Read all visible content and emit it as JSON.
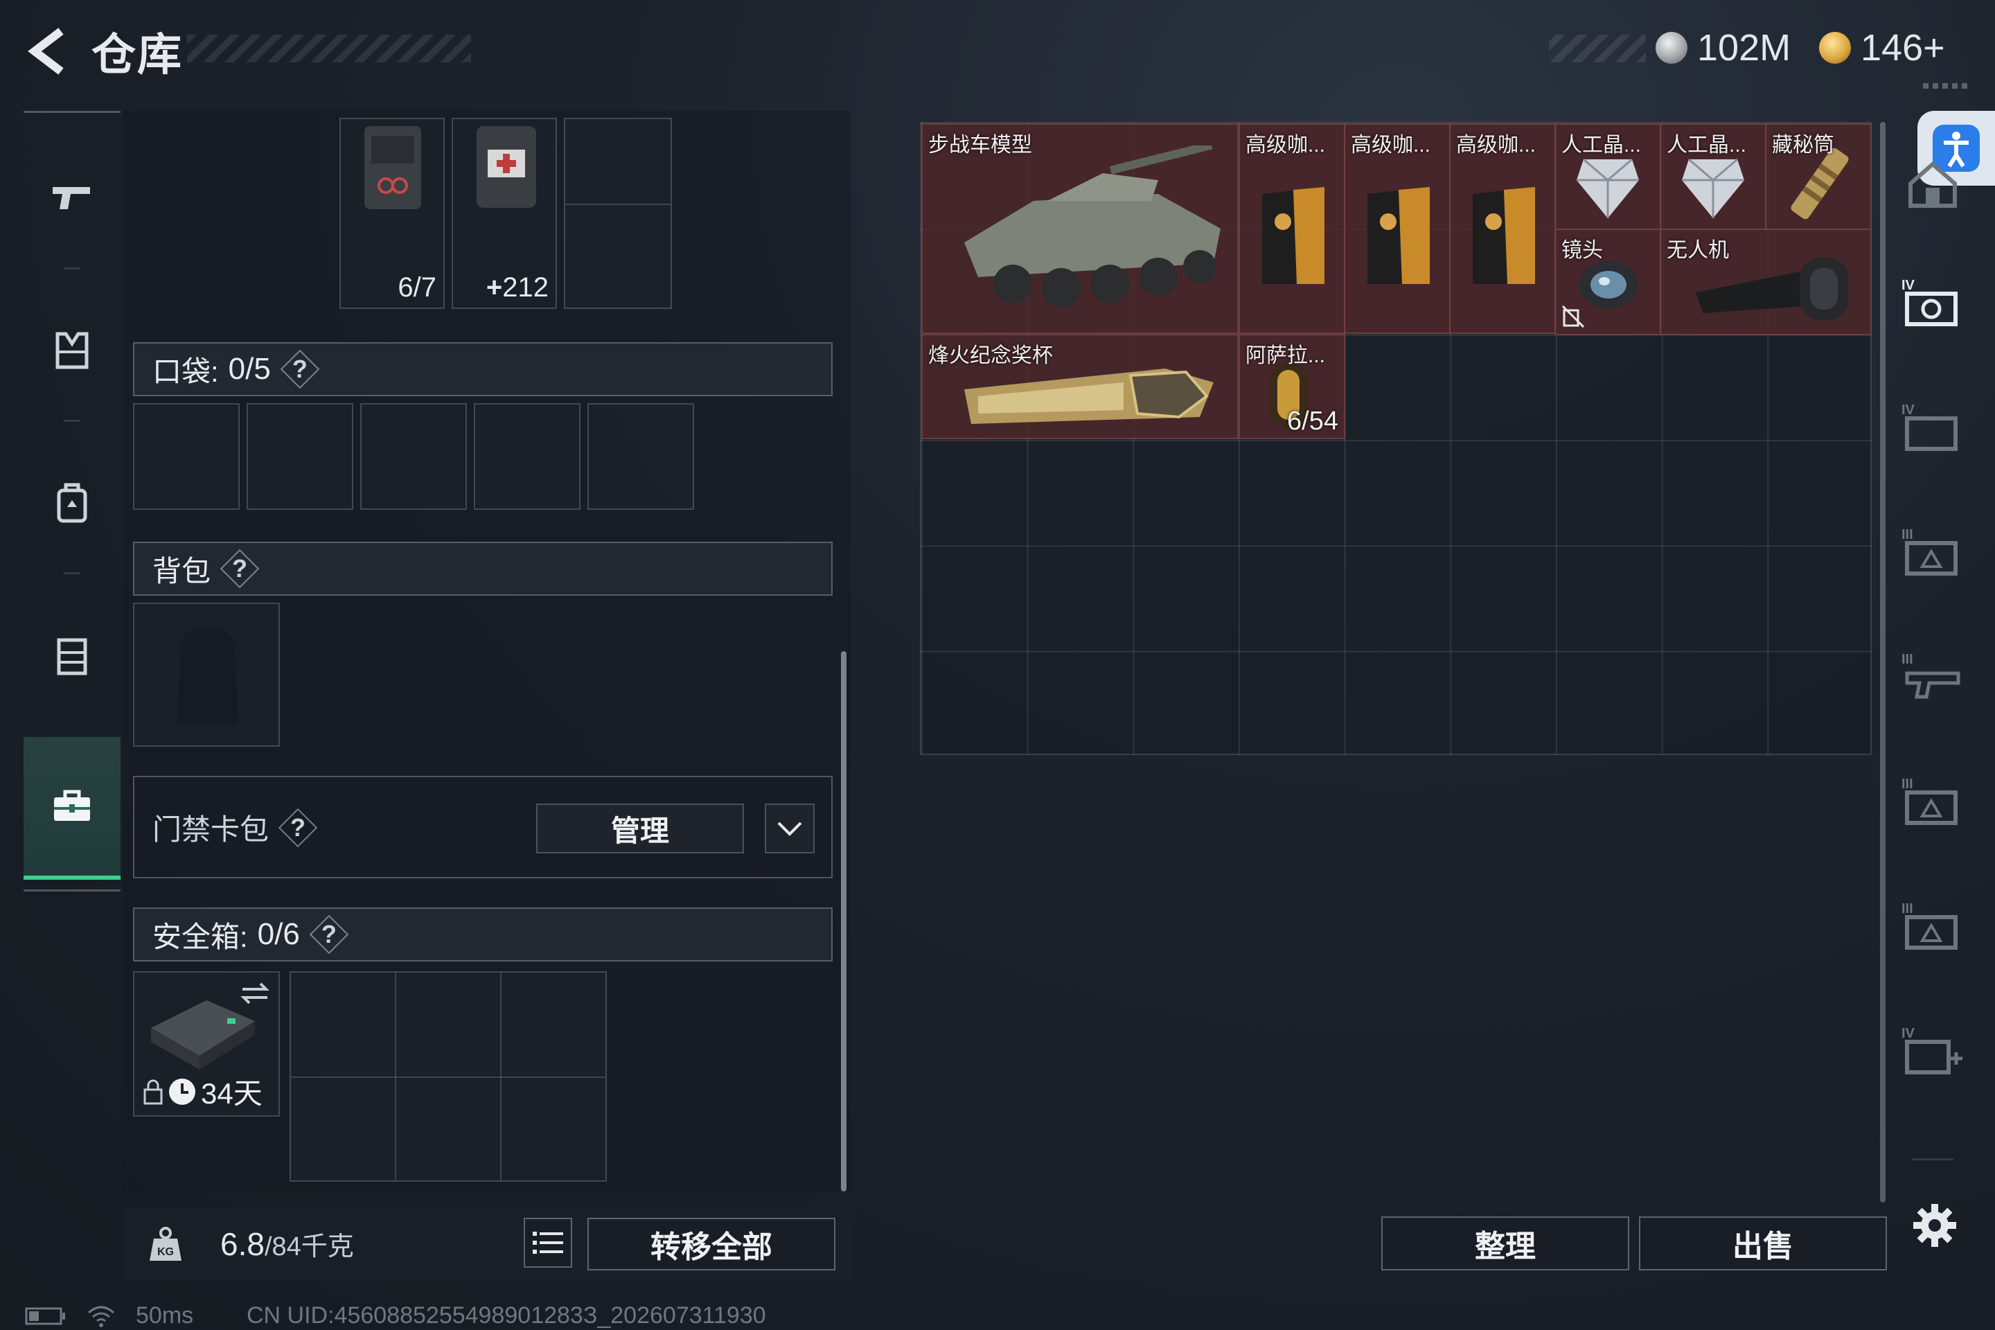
{
  "header": {
    "title": "仓库",
    "currencies": [
      {
        "icon": "coin-silver-icon",
        "value": "102M"
      },
      {
        "icon": "coin-gold-icon",
        "value": "146+"
      }
    ]
  },
  "left_rail": {
    "items": [
      {
        "icon": "gun-icon"
      },
      {
        "icon": "armor-vest-icon"
      },
      {
        "icon": "backpack-icon"
      },
      {
        "icon": "rig-icon"
      },
      {
        "icon": "briefcase-icon",
        "active": true
      }
    ]
  },
  "loadout": {
    "top_slots": [
      {
        "icon": "tool-pouch-icon",
        "count": "6/7"
      },
      {
        "icon": "medkit-pouch-icon",
        "count": "212",
        "count_prefix": "+"
      },
      {
        "icon": "empty",
        "count": ""
      }
    ],
    "pocket": {
      "label": "口袋:",
      "value": "0/5",
      "help": "?"
    },
    "backpack": {
      "label": "背包",
      "help": "?"
    },
    "keycard": {
      "label": "门禁卡包",
      "help": "?",
      "manage_label": "管理"
    },
    "safebox": {
      "label": "安全箱:",
      "value": "0/6",
      "help": "?",
      "timer": "34天"
    }
  },
  "bottom_bar": {
    "weight_value": "6.8",
    "weight_max": "/84千克",
    "transfer_all_label": "转移全部"
  },
  "stash": {
    "items": [
      {
        "name": "步战车模型",
        "icon": "ifv-model-icon"
      },
      {
        "name": "高级咖...",
        "icon": "coffee-bag-icon"
      },
      {
        "name": "高级咖...",
        "icon": "coffee-bag-icon"
      },
      {
        "name": "高级咖...",
        "icon": "coffee-bag-icon"
      },
      {
        "name": "人工晶...",
        "icon": "crystal-icon"
      },
      {
        "name": "人工晶...",
        "icon": "crystal-icon"
      },
      {
        "name": "藏秘筒",
        "icon": "cryptex-icon"
      },
      {
        "name": "镜头",
        "icon": "lens-icon"
      },
      {
        "name": "无人机",
        "icon": "drone-icon"
      },
      {
        "name": "烽火纪念奖杯",
        "icon": "trophy-icon"
      },
      {
        "name": "阿萨拉...",
        "icon": "asala-icon",
        "count": "6/54"
      }
    ],
    "sort_label": "整理",
    "sell_label": "出售"
  },
  "status_bar": {
    "ping": "50ms",
    "uid": "CN UID:4560885255498901283З_202607311930"
  },
  "colors": {
    "accent": "#3fcf8e",
    "item_bg": "#52282a",
    "access_button": "#2b7de9"
  }
}
